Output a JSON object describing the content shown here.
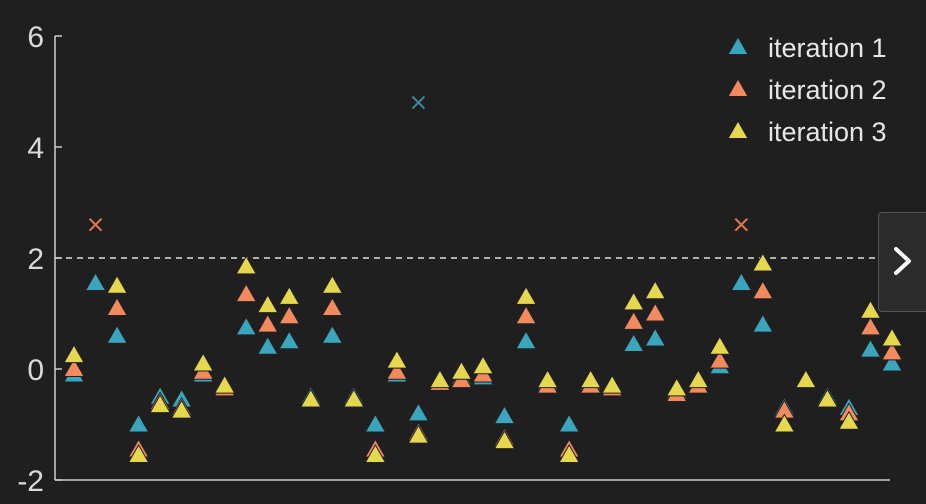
{
  "chart_data": {
    "type": "scatter",
    "ylim": [
      -2,
      6
    ],
    "yticks": [
      -2,
      0,
      2,
      4,
      6
    ],
    "ytick_labels": [
      "-2",
      "0",
      "2",
      "4",
      "6"
    ],
    "threshold": 2,
    "grid": false,
    "legend_placement": "top-right",
    "colors": {
      "iteration 1": "#3aa6bd",
      "iteration 2": "#f28a5e",
      "iteration 3": "#e6d84e"
    },
    "series": [
      {
        "name": "iteration 1",
        "marker": "triangle",
        "color": "#3aa6bd",
        "x": [
          1,
          2,
          3,
          4,
          5,
          6,
          7,
          8,
          9,
          10,
          11,
          12,
          13,
          14,
          15,
          16,
          17,
          18,
          19,
          20,
          21,
          22,
          23,
          24,
          25,
          26,
          27,
          28,
          29,
          30,
          31,
          32,
          33,
          34,
          35,
          36,
          37,
          38,
          39
        ],
        "values": [
          -0.1,
          1.55,
          0.6,
          -1.0,
          -0.5,
          -0.55,
          -0.1,
          -0.3,
          0.75,
          0.4,
          0.5,
          -0.5,
          0.6,
          -0.5,
          -1.0,
          -0.1,
          -0.8,
          -0.2,
          -0.15,
          -0.15,
          -0.85,
          0.5,
          -0.25,
          -1.0,
          -0.25,
          -0.3,
          0.45,
          0.55,
          -0.4,
          -0.3,
          0.05,
          1.55,
          0.8,
          -0.7,
          -0.2,
          -0.5,
          -0.7,
          0.35,
          0.1
        ]
      },
      {
        "name": "iteration 2",
        "marker": "triangle",
        "color": "#f28a5e",
        "x": [
          1,
          2,
          3,
          4,
          5,
          6,
          7,
          8,
          9,
          10,
          11,
          12,
          13,
          14,
          15,
          16,
          17,
          18,
          19,
          20,
          21,
          22,
          23,
          24,
          25,
          26,
          27,
          28,
          29,
          30,
          31,
          32,
          33,
          34,
          35,
          36,
          37,
          38,
          39
        ],
        "values": [
          0.0,
          null,
          1.1,
          -1.45,
          -0.6,
          -0.7,
          -0.05,
          -0.35,
          1.35,
          0.8,
          0.95,
          -0.55,
          1.1,
          -0.55,
          -1.45,
          -0.05,
          -1.15,
          -0.25,
          -0.2,
          -0.1,
          -1.25,
          0.95,
          -0.3,
          -1.45,
          -0.3,
          -0.35,
          0.85,
          1.0,
          -0.45,
          -0.3,
          0.15,
          null,
          1.4,
          -0.75,
          -0.2,
          -0.55,
          -0.8,
          0.75,
          0.3
        ]
      },
      {
        "name": "iteration 3",
        "marker": "triangle",
        "color": "#e6d84e",
        "x": [
          1,
          2,
          3,
          4,
          5,
          6,
          7,
          8,
          9,
          10,
          11,
          12,
          13,
          14,
          15,
          16,
          17,
          18,
          19,
          20,
          21,
          22,
          23,
          24,
          25,
          26,
          27,
          28,
          29,
          30,
          31,
          32,
          33,
          34,
          35,
          36,
          37,
          38,
          39
        ],
        "values": [
          0.25,
          null,
          1.5,
          -1.55,
          -0.65,
          -0.75,
          0.1,
          -0.3,
          1.85,
          1.15,
          1.3,
          -0.55,
          1.5,
          -0.55,
          -1.55,
          0.15,
          -1.2,
          -0.2,
          -0.05,
          0.05,
          -1.3,
          1.3,
          -0.2,
          -1.55,
          -0.2,
          -0.3,
          1.2,
          1.4,
          -0.35,
          -0.2,
          0.4,
          null,
          1.9,
          -1.0,
          -0.2,
          -0.55,
          -0.95,
          1.05,
          0.55
        ]
      },
      {
        "name": "",
        "marker": "x",
        "color": "#e07a50",
        "x": [
          2,
          32
        ],
        "values": [
          2.6,
          2.6
        ]
      },
      {
        "name": "",
        "marker": "x",
        "color": "#3a8aa0",
        "x": [
          17
        ],
        "values": [
          4.8
        ]
      }
    ],
    "legend": [
      "iteration 1",
      "iteration 2",
      "iteration 3"
    ]
  },
  "nav": {
    "next_icon": "chevron-right-icon"
  }
}
